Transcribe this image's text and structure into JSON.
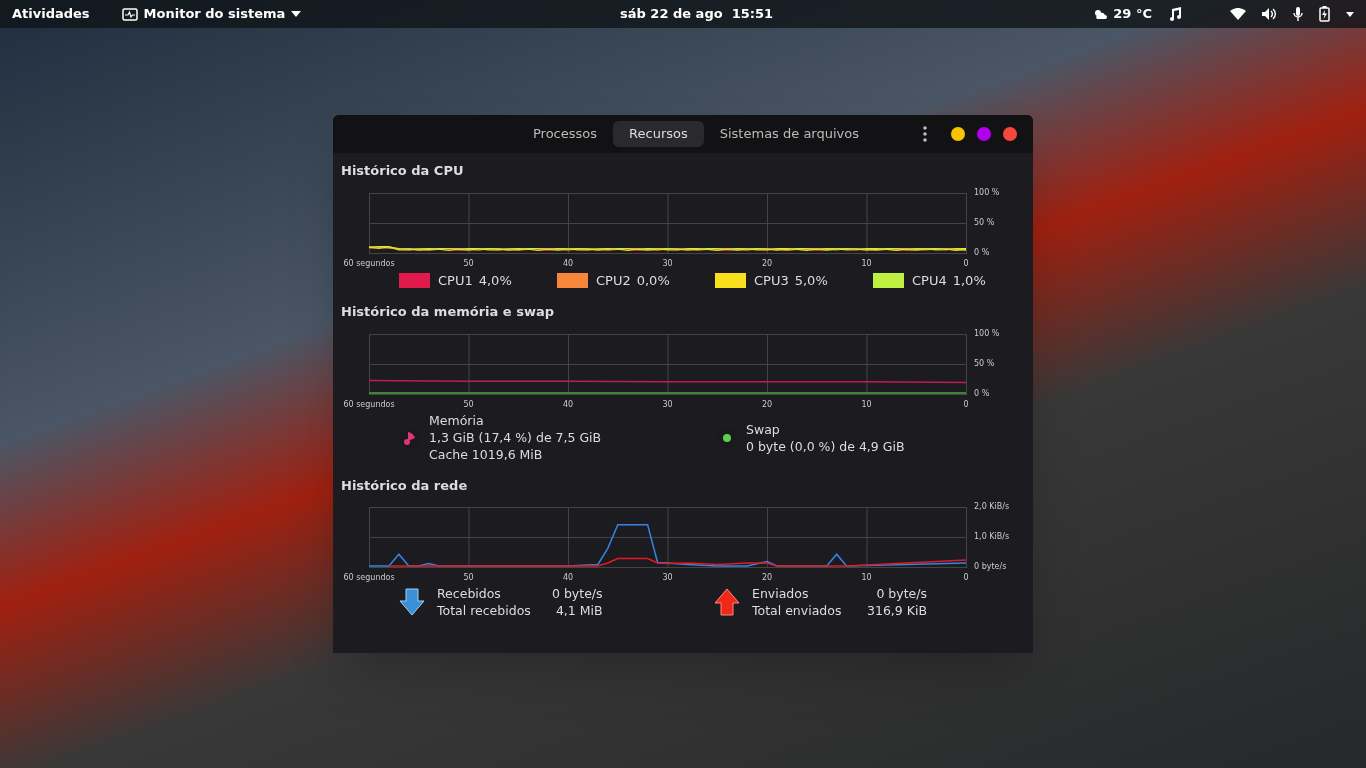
{
  "top_bar": {
    "activities": "Atividades",
    "app_menu": "Monitor do sistema",
    "clock": "sáb 22 de ago  15:51",
    "weather": "29 °C"
  },
  "window": {
    "tabs": [
      {
        "label": "Processos",
        "selected": false
      },
      {
        "label": "Recursos",
        "selected": true
      },
      {
        "label": "Sistemas de arquivos",
        "selected": false
      }
    ]
  },
  "cpu": {
    "title": "Histórico da CPU",
    "x_labels": [
      "60 segundos",
      "50",
      "40",
      "30",
      "20",
      "10",
      "0"
    ],
    "y_labels": [
      "100 %",
      "50 %",
      "0 %"
    ],
    "legend": [
      {
        "name": "CPU1",
        "value": "4,0%",
        "color": "#e01b4c"
      },
      {
        "name": "CPU2",
        "value": "0,0%",
        "color": "#f6863a"
      },
      {
        "name": "CPU3",
        "value": "5,0%",
        "color": "#f8e01c"
      },
      {
        "name": "CPU4",
        "value": "1,0%",
        "color": "#bff240"
      }
    ]
  },
  "memory": {
    "title": "Histórico da memória e swap",
    "chart_data": {
      "type": "line",
      "grid": true,
      "xlim": [
        60,
        0
      ],
      "ylim": [
        0,
        100
      ],
      "xticks": [
        {
          "value": 60,
          "label": "60 segundos"
        },
        {
          "value": 50,
          "label": "50"
        },
        {
          "value": 40,
          "label": "40"
        },
        {
          "value": 30,
          "label": "30"
        },
        {
          "value": 20,
          "label": "20"
        },
        {
          "value": 10,
          "label": "10"
        },
        {
          "value": 0,
          "label": "0"
        }
      ],
      "yticks": [
        {
          "value": 0,
          "label": "0 %"
        },
        {
          "value": 50,
          "label": "50 %"
        },
        {
          "value": 100,
          "label": "100 %"
        }
      ],
      "x": [
        60,
        50,
        40,
        30,
        20,
        10,
        0
      ],
      "series": [
        {
          "name": "Memória",
          "color": "#c01c54",
          "values": [
            21,
            20,
            20,
            19,
            19,
            19,
            18
          ]
        },
        {
          "name": "Swap",
          "color": "#4ca640",
          "values": [
            0,
            0,
            0,
            0,
            0,
            0,
            0
          ]
        }
      ]
    },
    "items": [
      {
        "kind": "pie",
        "color": "#e0337a",
        "lines": [
          "1,3 GiB (17,4 %) de 7,5 GiB",
          "Cache 1019,6 MiB"
        ]
      },
      {
        "kind": "dot",
        "color": "#5fce4e",
        "lines": [
          "0 byte (0,0 %) de 4,9 GiB"
        ]
      }
    ]
  },
  "network": {
    "title": "Histórico da rede",
    "chart_data": {
      "type": "line",
      "grid": true,
      "xlim": [
        60,
        0
      ],
      "ylim": [
        0,
        2
      ],
      "xticks": [
        {
          "value": 60,
          "label": "60 segundos"
        },
        {
          "value": 50,
          "label": "50"
        },
        {
          "value": 40,
          "label": "40"
        },
        {
          "value": 30,
          "label": "30"
        },
        {
          "value": 20,
          "label": "20"
        },
        {
          "value": 10,
          "label": "10"
        },
        {
          "value": 0,
          "label": "0"
        }
      ],
      "yticks": [
        {
          "value": 0,
          "label": "0 byte/s"
        },
        {
          "value": 1,
          "label": "1,0 KiB/s"
        },
        {
          "value": 2,
          "label": "2,0 KiB/s"
        }
      ],
      "x": [
        60,
        58,
        57,
        56,
        55,
        54,
        53,
        40,
        37,
        36,
        35,
        32,
        31,
        30,
        28,
        25,
        22,
        20,
        19,
        14,
        13,
        12,
        0
      ],
      "series": [
        {
          "name": "Recebidos",
          "color": "#3584e4",
          "values": [
            0,
            0,
            0.4,
            0,
            0,
            0.08,
            0,
            0,
            0.05,
            0.6,
            1.4,
            1.4,
            0.12,
            0.1,
            0.05,
            0,
            0,
            0.15,
            0,
            0,
            0.4,
            0,
            0.1
          ]
        },
        {
          "name": "Enviados",
          "color": "#e01b24",
          "values": [
            null,
            0,
            0,
            0,
            0,
            0,
            0,
            0,
            0,
            0.1,
            0.25,
            0.25,
            0.1,
            0.08,
            0.1,
            0.05,
            0.1,
            0.1,
            0,
            0,
            0,
            0,
            0.2
          ]
        }
      ]
    },
    "items": [
      {
        "kind": "down",
        "rate": "0 byte/s",
        "total_label": "Total recebidos",
        "total": "4,1 MiB"
      },
      {
        "kind": "up",
        "rate": "0 byte/s",
        "total_label": "Total enviados",
        "total": "316,9 KiB"
      }
    ]
  }
}
